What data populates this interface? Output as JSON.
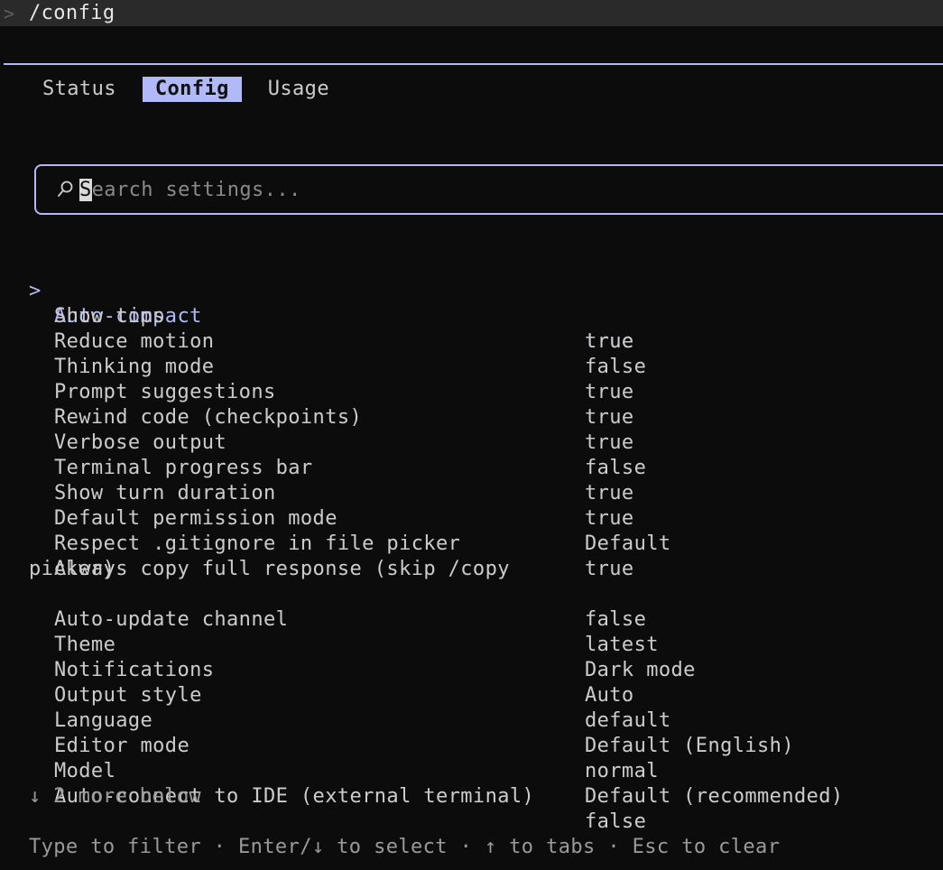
{
  "command_bar": {
    "prompt": ">",
    "command": "/config"
  },
  "tabs": [
    {
      "label": "Status"
    },
    {
      "label": "Config"
    },
    {
      "label": "Usage"
    }
  ],
  "search": {
    "cursor_char": "S",
    "placeholder_rest": "earch settings..."
  },
  "settings": {
    "selected_marker": ">",
    "items": [
      {
        "label": "Auto-compact",
        "value": "true"
      },
      {
        "label": "Show tips",
        "value": "true"
      },
      {
        "label": "Reduce motion",
        "value": "false"
      },
      {
        "label": "Thinking mode",
        "value": "true"
      },
      {
        "label": "Prompt suggestions",
        "value": "true"
      },
      {
        "label": "Rewind code (checkpoints)",
        "value": "true"
      },
      {
        "label": "Verbose output",
        "value": "false"
      },
      {
        "label": "Terminal progress bar",
        "value": "true"
      },
      {
        "label": "Show turn duration",
        "value": "true"
      },
      {
        "label": "Default permission mode",
        "value": "Default"
      },
      {
        "label": "Respect .gitignore in file picker",
        "value": "true"
      },
      {
        "label": "Always copy full response (skip /copy",
        "label_cont": "picker)",
        "value": "false"
      },
      {
        "label": "Auto-update channel",
        "value": "latest"
      },
      {
        "label": "Theme",
        "value": "Dark mode"
      },
      {
        "label": "Notifications",
        "value": "Auto"
      },
      {
        "label": "Output style",
        "value": "default"
      },
      {
        "label": "Language",
        "value": "Default (English)"
      },
      {
        "label": "Editor mode",
        "value": "normal"
      },
      {
        "label": "Model",
        "value": "Default (recommended)"
      },
      {
        "label": "Auto-connect to IDE (external terminal)",
        "value": "false"
      }
    ]
  },
  "more_below": "↓ 2 more below",
  "footer_hint": "Type to filter · Enter/↓ to select · ↑ to tabs · Esc to clear",
  "colors": {
    "accent": "#b1b9f9",
    "background": "#0c0c0c",
    "text": "#cccccc",
    "dim_text": "#9a9a9a"
  }
}
